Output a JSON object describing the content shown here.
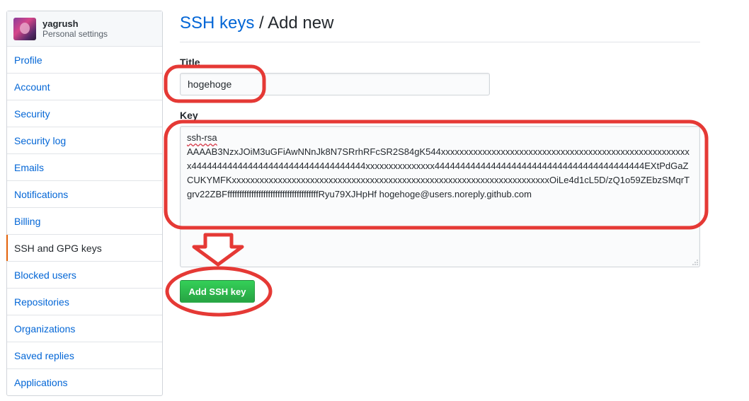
{
  "sidebar": {
    "username": "yagrush",
    "subtitle": "Personal settings",
    "items": [
      {
        "label": "Profile",
        "selected": false
      },
      {
        "label": "Account",
        "selected": false
      },
      {
        "label": "Security",
        "selected": false
      },
      {
        "label": "Security log",
        "selected": false
      },
      {
        "label": "Emails",
        "selected": false
      },
      {
        "label": "Notifications",
        "selected": false
      },
      {
        "label": "Billing",
        "selected": false
      },
      {
        "label": "SSH and GPG keys",
        "selected": true
      },
      {
        "label": "Blocked users",
        "selected": false
      },
      {
        "label": "Repositories",
        "selected": false
      },
      {
        "label": "Organizations",
        "selected": false
      },
      {
        "label": "Saved replies",
        "selected": false
      },
      {
        "label": "Applications",
        "selected": false
      }
    ]
  },
  "header": {
    "breadcrumb": "SSH keys",
    "separator": "/",
    "title": "Add new"
  },
  "form": {
    "title_label": "Title",
    "title_value": "hogehoge",
    "key_label": "Key",
    "key_first_line": "ssh-rsa",
    "key_rest": "AAAAB3NzxJOiM3uGFiAwNNnJk8N7SRrhRFcSR2S84gK544xxxxxxxxxxxxxxxxxxxxxxxxxxxxxxxxxxxxxxxxxxxxxxxxxxxxxxx4444444444444444444444444444444444xxxxxxxxxxxxxxx44444444444444444444444444444444444444444EXtPdGaZCUKYMFKxxxxxxxxxxxxxxxxxxxxxxxxxxxxxxxxxxxxxxxxxxxxxxxxxxxxxxxxxxxxxxxxxxxxxOiLe4d1cL5D/zQ1o59ZEbzSMqrTgrv22ZBFffffffffffffffffffffffffffffffffffffffRyu79XJHpHf hogehoge@users.noreply.github.com",
    "submit_label": "Add SSH key"
  },
  "colors": {
    "link": "#0366d6",
    "selected_accent": "#e36209",
    "button_green": "#28a745",
    "annotation_red": "#e53935"
  }
}
